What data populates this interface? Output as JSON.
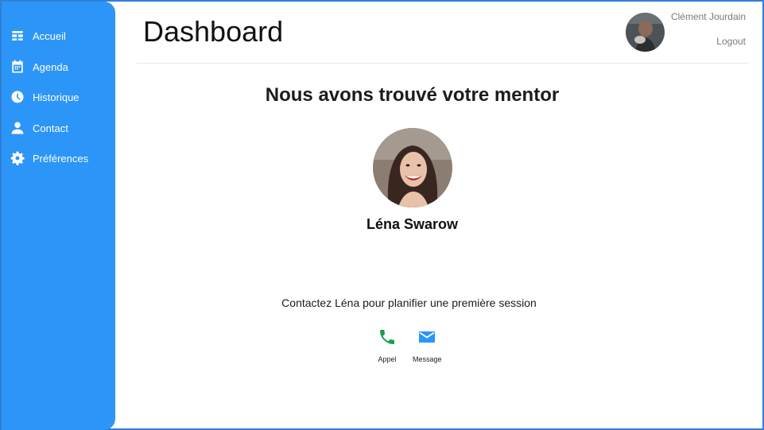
{
  "sidebar": {
    "items": [
      {
        "label": "Accueil",
        "icon": "dashboard-icon"
      },
      {
        "label": "Agenda",
        "icon": "calendar-icon"
      },
      {
        "label": "Historique",
        "icon": "clock-icon"
      },
      {
        "label": "Contact",
        "icon": "person-icon"
      },
      {
        "label": "Préférences",
        "icon": "gear-icon"
      }
    ]
  },
  "header": {
    "title": "Dashboard",
    "user_name": "Clément Jourdain",
    "logout_label": "Logout"
  },
  "main": {
    "heading": "Nous avons trouvé votre mentor",
    "mentor_name": "Léna Swarow",
    "contact_text": "Contactez Léna pour planifier une première session",
    "actions": [
      {
        "label": "Appel",
        "icon": "phone-icon"
      },
      {
        "label": "Message",
        "icon": "mail-icon"
      }
    ]
  },
  "colors": {
    "sidebar": "#2c95f8",
    "phone": "#19a04a",
    "mail": "#2c95f8"
  }
}
